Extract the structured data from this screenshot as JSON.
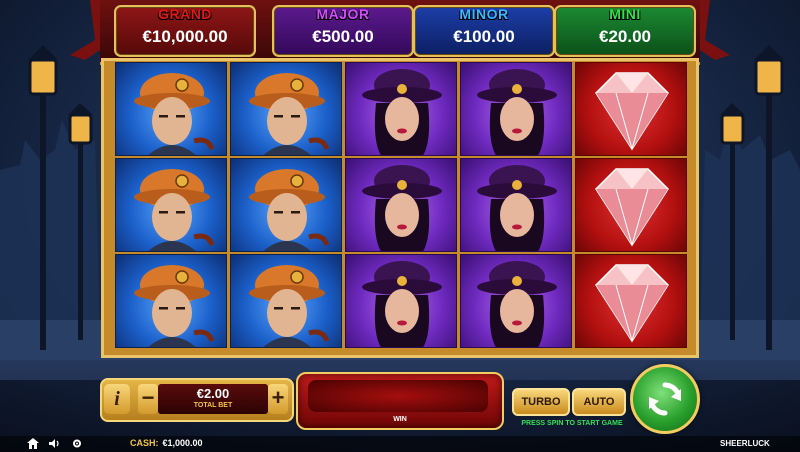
{
  "jackpots": {
    "grand": {
      "name": "GRAND",
      "value": "€10,000.00",
      "color": "#e01818"
    },
    "major": {
      "name": "MAJOR",
      "value": "€500.00",
      "color": "#d24cff"
    },
    "minor": {
      "name": "MINOR",
      "value": "€100.00",
      "color": "#39b8ff"
    },
    "mini": {
      "name": "MINI",
      "value": "€20.00",
      "color": "#36e04a"
    }
  },
  "reels": [
    [
      "detective-man",
      "detective-man",
      "detective-man"
    ],
    [
      "detective-man",
      "detective-man",
      "detective-man"
    ],
    [
      "detective-woman",
      "detective-woman",
      "detective-woman"
    ],
    [
      "detective-woman",
      "detective-woman",
      "detective-woman"
    ],
    [
      "red-diamond",
      "red-diamond",
      "red-diamond"
    ]
  ],
  "controls": {
    "info_label": "i",
    "minus_label": "−",
    "plus_label": "+",
    "bet_value": "€2.00",
    "bet_label": "TOTAL BET",
    "win_label": "WIN",
    "turbo_label": "TURBO",
    "auto_label": "AUTO",
    "press_spin": "PRESS SPIN TO START GAME"
  },
  "footer": {
    "cash_label": "CASH:",
    "cash_value": "€1,000.00",
    "brand": "SHEERLUCK",
    "icons": [
      "home-icon",
      "sound-icon",
      "settings-icon"
    ]
  },
  "colors": {
    "gold": "#e4b547",
    "reel_blue": "#1b5fc9",
    "reel_purple": "#6f2ac0",
    "reel_red": "#b31010",
    "spin_green": "#2aa02d"
  }
}
